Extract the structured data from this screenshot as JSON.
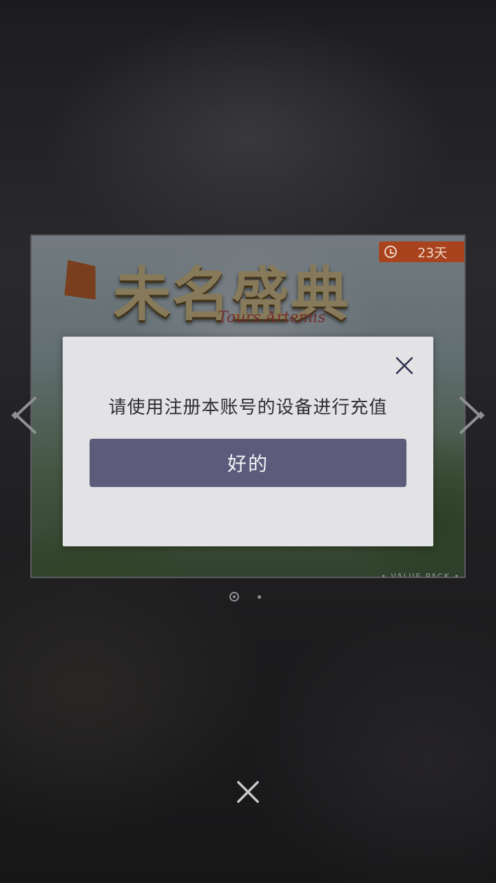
{
  "banner": {
    "title": "未名盛典",
    "subtitle": "Tours Artemis",
    "timer": "23天",
    "tag": "• VALUE PACK •"
  },
  "dialog": {
    "message": "请使用注册本账号的设备进行充值",
    "confirm_label": "好的",
    "close_icon": "close-icon"
  },
  "pager": {
    "pages": 2,
    "current": 1
  },
  "colors": {
    "dialog_bg": "#e3e3e5",
    "button_bg": "#5c5b7b",
    "timer_badge": "#a8431e"
  }
}
